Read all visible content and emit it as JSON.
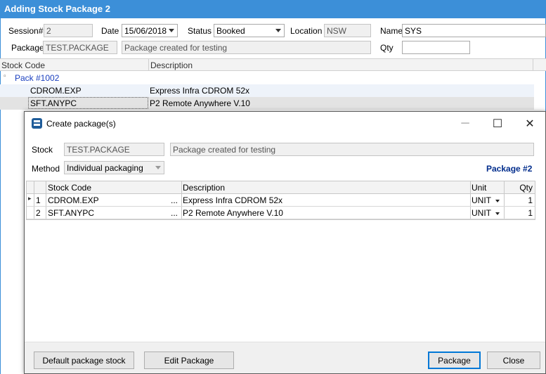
{
  "window": {
    "title": "Adding Stock Package 2"
  },
  "header": {
    "session_label": "Session#",
    "session_value": "2",
    "date_label": "Date",
    "date_value": "15/06/2018",
    "status_label": "Status",
    "status_value": "Booked",
    "location_label": "Location",
    "location_value": "NSW",
    "name_label": "Name",
    "name_value": "SYS",
    "package_label": "Package",
    "package_value": "TEST.PACKAGE",
    "package_desc": "Package created for testing",
    "qty_label": "Qty",
    "qty_value": ""
  },
  "bg_grid": {
    "columns": [
      "Stock Code",
      "Description"
    ],
    "tree_toggle": "▫",
    "group": "Pack #1002",
    "rows": [
      {
        "code": "CDROM.EXP",
        "desc": "Express Infra CDROM 52x"
      },
      {
        "code": "SFT.ANYPC",
        "desc": "P2 Remote Anywhere V.10"
      }
    ]
  },
  "dialog": {
    "title": "Create package(s)",
    "stock_label": "Stock",
    "stock_value": "TEST.PACKAGE",
    "stock_desc": "Package created for testing",
    "method_label": "Method",
    "method_value": "Individual packaging",
    "package_tag": "Package #2",
    "grid": {
      "columns": [
        "Stock Code",
        "Description",
        "Unit",
        "Qty"
      ],
      "rows": [
        {
          "num": "1",
          "code": "CDROM.EXP",
          "desc": "Express Infra CDROM 52x",
          "unit": "UNIT",
          "qty": "1"
        },
        {
          "num": "2",
          "code": "SFT.ANYPC",
          "desc": "P2 Remote Anywhere V.10",
          "unit": "UNIT",
          "qty": "1"
        }
      ],
      "ellipsis": "...",
      "row_marker": "▸"
    },
    "buttons": {
      "default_stock": "Default package stock",
      "edit_package": "Edit Package",
      "package": "Package",
      "close": "Close"
    }
  },
  "colors": {
    "titlebar": "#3c8fd8",
    "accent_text": "#002c8c",
    "link": "#1a3fbf"
  }
}
